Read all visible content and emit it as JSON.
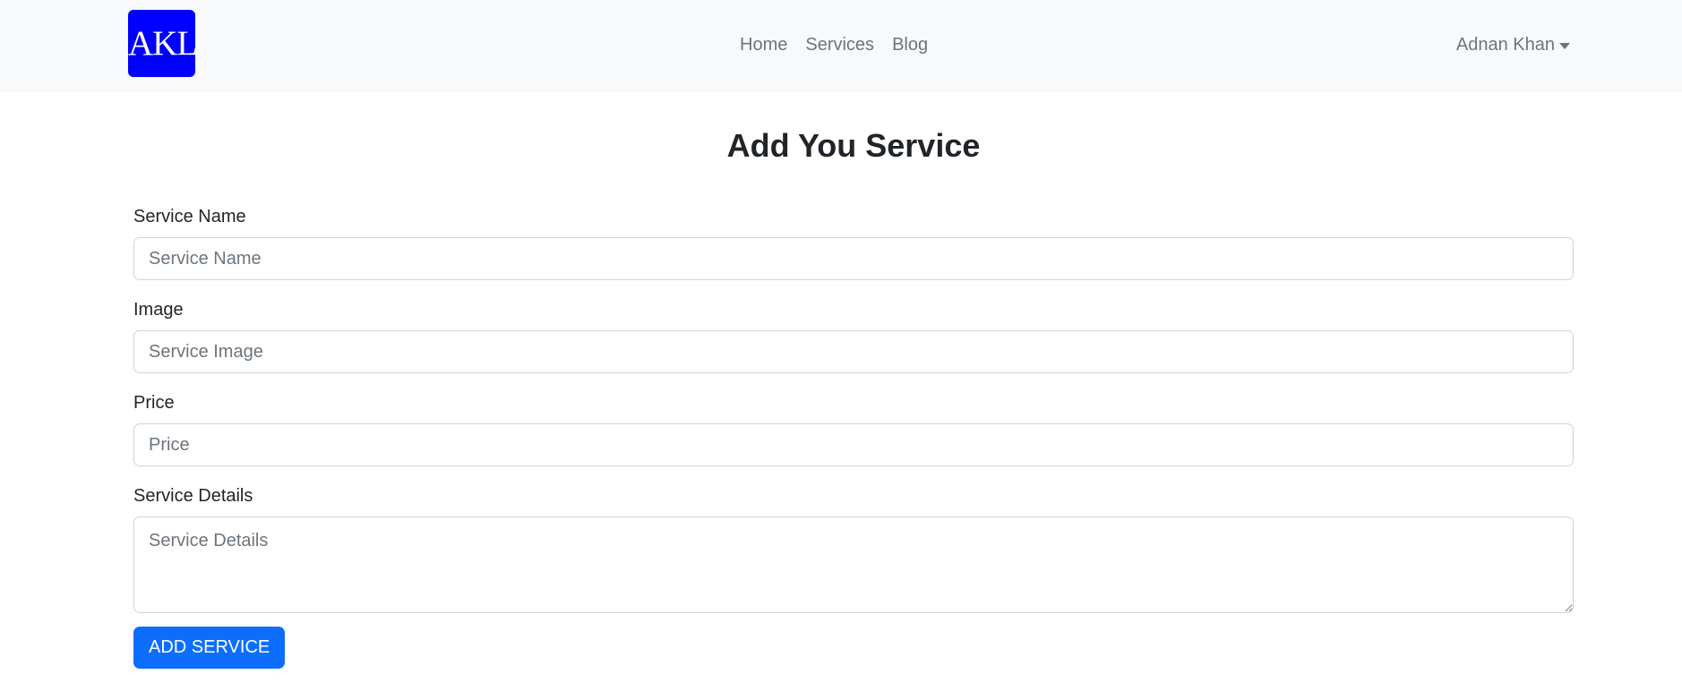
{
  "navbar": {
    "brand": "AKL",
    "links": [
      "Home",
      "Services",
      "Blog"
    ],
    "user_name": "Adnan Khan",
    "brand_color": "#0000ff"
  },
  "page": {
    "title": "Add You Service"
  },
  "form": {
    "service_name": {
      "label": "Service Name",
      "placeholder": "Service Name",
      "value": ""
    },
    "image": {
      "label": "Image",
      "placeholder": "Service Image",
      "value": ""
    },
    "price": {
      "label": "Price",
      "placeholder": "Price",
      "value": ""
    },
    "details": {
      "label": "Service Details",
      "placeholder": "Service Details",
      "value": ""
    },
    "submit_label": "ADD SERVICE",
    "submit_color": "#0d6efd"
  }
}
